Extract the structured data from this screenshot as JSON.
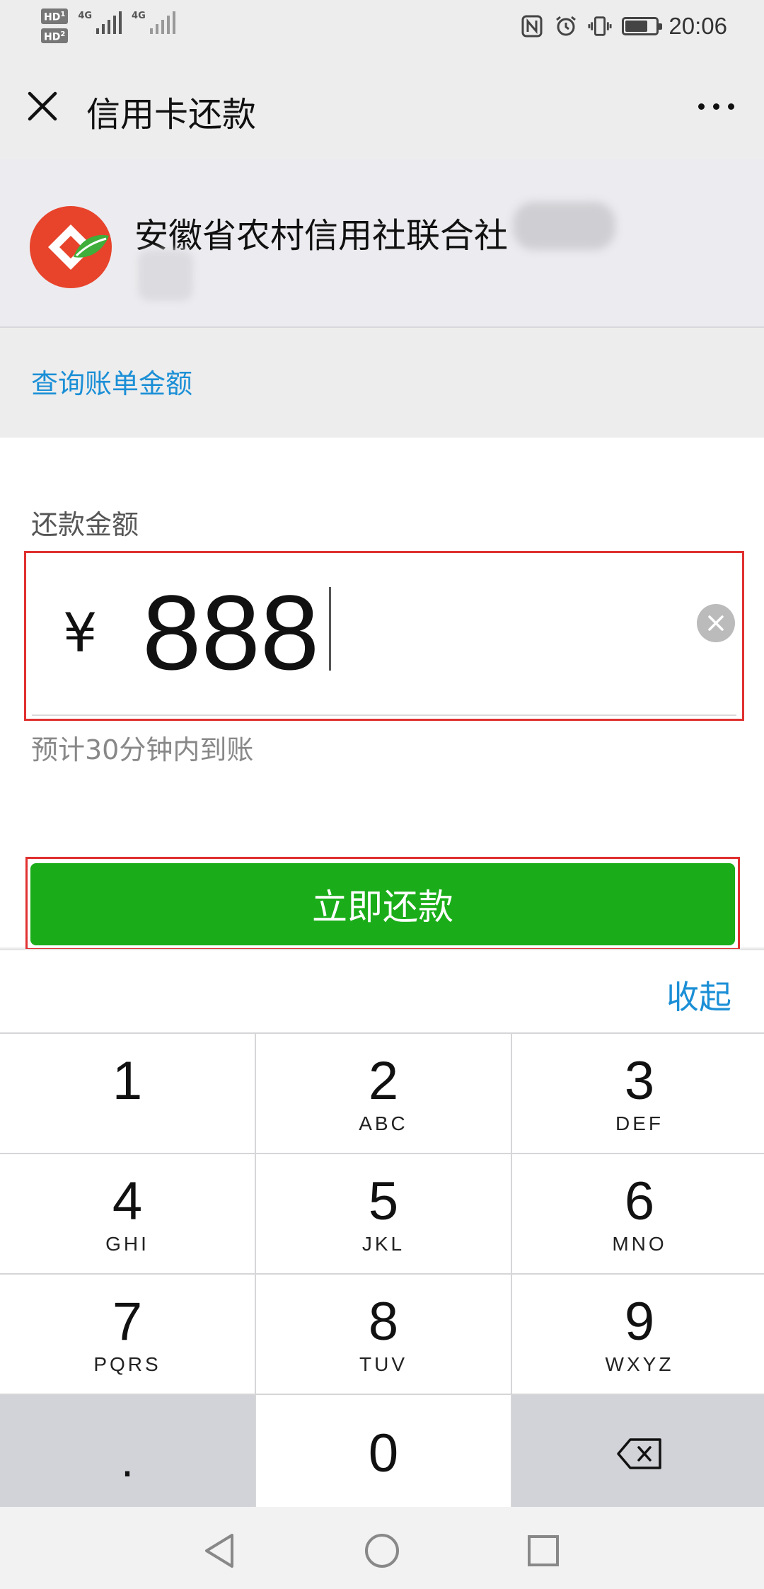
{
  "status_bar": {
    "sim1_label": "HD",
    "sim1_index": "1",
    "sim2_label": "HD",
    "sim2_index": "2",
    "network1": "4G",
    "network2": "4G",
    "time": "20:06",
    "icons": [
      "nfc-icon",
      "alarm-icon",
      "vibrate-icon",
      "battery-icon"
    ]
  },
  "header": {
    "title": "信用卡还款"
  },
  "bank": {
    "name": "安徽省农村信用社联合社"
  },
  "query": {
    "label": "查询账单金额"
  },
  "repay": {
    "amount_label": "还款金额",
    "currency": "¥",
    "amount": "888",
    "eta": "预计30分钟内到账",
    "submit_label": "立即还款"
  },
  "keyboard": {
    "collapse_label": "收起",
    "keys": [
      {
        "num": "1",
        "letters": ""
      },
      {
        "num": "2",
        "letters": "ABC"
      },
      {
        "num": "3",
        "letters": "DEF"
      },
      {
        "num": "4",
        "letters": "GHI"
      },
      {
        "num": "5",
        "letters": "JKL"
      },
      {
        "num": "6",
        "letters": "MNO"
      },
      {
        "num": "7",
        "letters": "PQRS"
      },
      {
        "num": "8",
        "letters": "TUV"
      },
      {
        "num": "9",
        "letters": "WXYZ"
      }
    ],
    "dot": ".",
    "zero": "0"
  },
  "colors": {
    "accent_blue": "#1b8fd6",
    "primary_green": "#1aad19",
    "highlight_red": "#e03030"
  }
}
